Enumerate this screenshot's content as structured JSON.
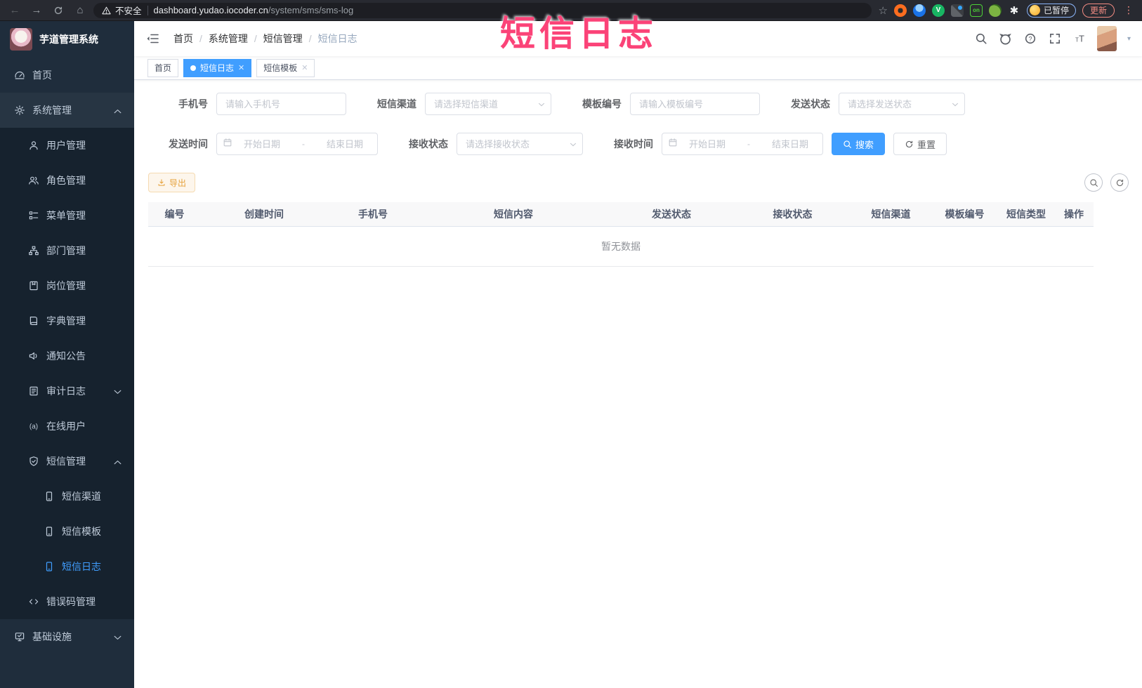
{
  "annotation": {
    "title": "短信日志"
  },
  "browser": {
    "security_label": "不安全",
    "url_host": "dashboard.yudao.iocoder.cn",
    "url_path": "/system/sms/sms-log",
    "paused_label": "已暂停",
    "update_label": "更新"
  },
  "sidebar": {
    "title": "芋道管理系统",
    "items": [
      {
        "label": "首页"
      },
      {
        "label": "系统管理"
      },
      {
        "label": "用户管理"
      },
      {
        "label": "角色管理"
      },
      {
        "label": "菜单管理"
      },
      {
        "label": "部门管理"
      },
      {
        "label": "岗位管理"
      },
      {
        "label": "字典管理"
      },
      {
        "label": "通知公告"
      },
      {
        "label": "审计日志"
      },
      {
        "label": "在线用户"
      },
      {
        "label": "短信管理"
      },
      {
        "label": "短信渠道"
      },
      {
        "label": "短信模板"
      },
      {
        "label": "短信日志"
      },
      {
        "label": "错误码管理"
      },
      {
        "label": "基础设施"
      }
    ]
  },
  "breadcrumb": {
    "items": [
      "首页",
      "系统管理",
      "短信管理",
      "短信日志"
    ]
  },
  "tabs": [
    {
      "label": "首页"
    },
    {
      "label": "短信日志"
    },
    {
      "label": "短信模板"
    }
  ],
  "form": {
    "phone_label": "手机号",
    "phone_placeholder": "请输入手机号",
    "channel_label": "短信渠道",
    "channel_placeholder": "请选择短信渠道",
    "template_label": "模板编号",
    "template_placeholder": "请输入模板编号",
    "send_status_label": "发送状态",
    "send_status_placeholder": "请选择发送状态",
    "send_time_label": "发送时间",
    "receive_status_label": "接收状态",
    "receive_status_placeholder": "请选择接收状态",
    "receive_time_label": "接收时间",
    "date_start_placeholder": "开始日期",
    "date_end_placeholder": "结束日期",
    "date_separator": "-",
    "search_button": "搜索",
    "reset_button": "重置"
  },
  "toolbar": {
    "export_button": "导出"
  },
  "table": {
    "headers": [
      "编号",
      "创建时间",
      "手机号",
      "短信内容",
      "发送状态",
      "接收状态",
      "短信渠道",
      "模板编号",
      "短信类型",
      "操作"
    ],
    "empty_text": "暂无数据"
  },
  "colors": {
    "accent": "#409eff",
    "warning": "#e6a23c",
    "annotation_pink": "#fb4378",
    "sidebar_bg": "#1f2d3c"
  }
}
